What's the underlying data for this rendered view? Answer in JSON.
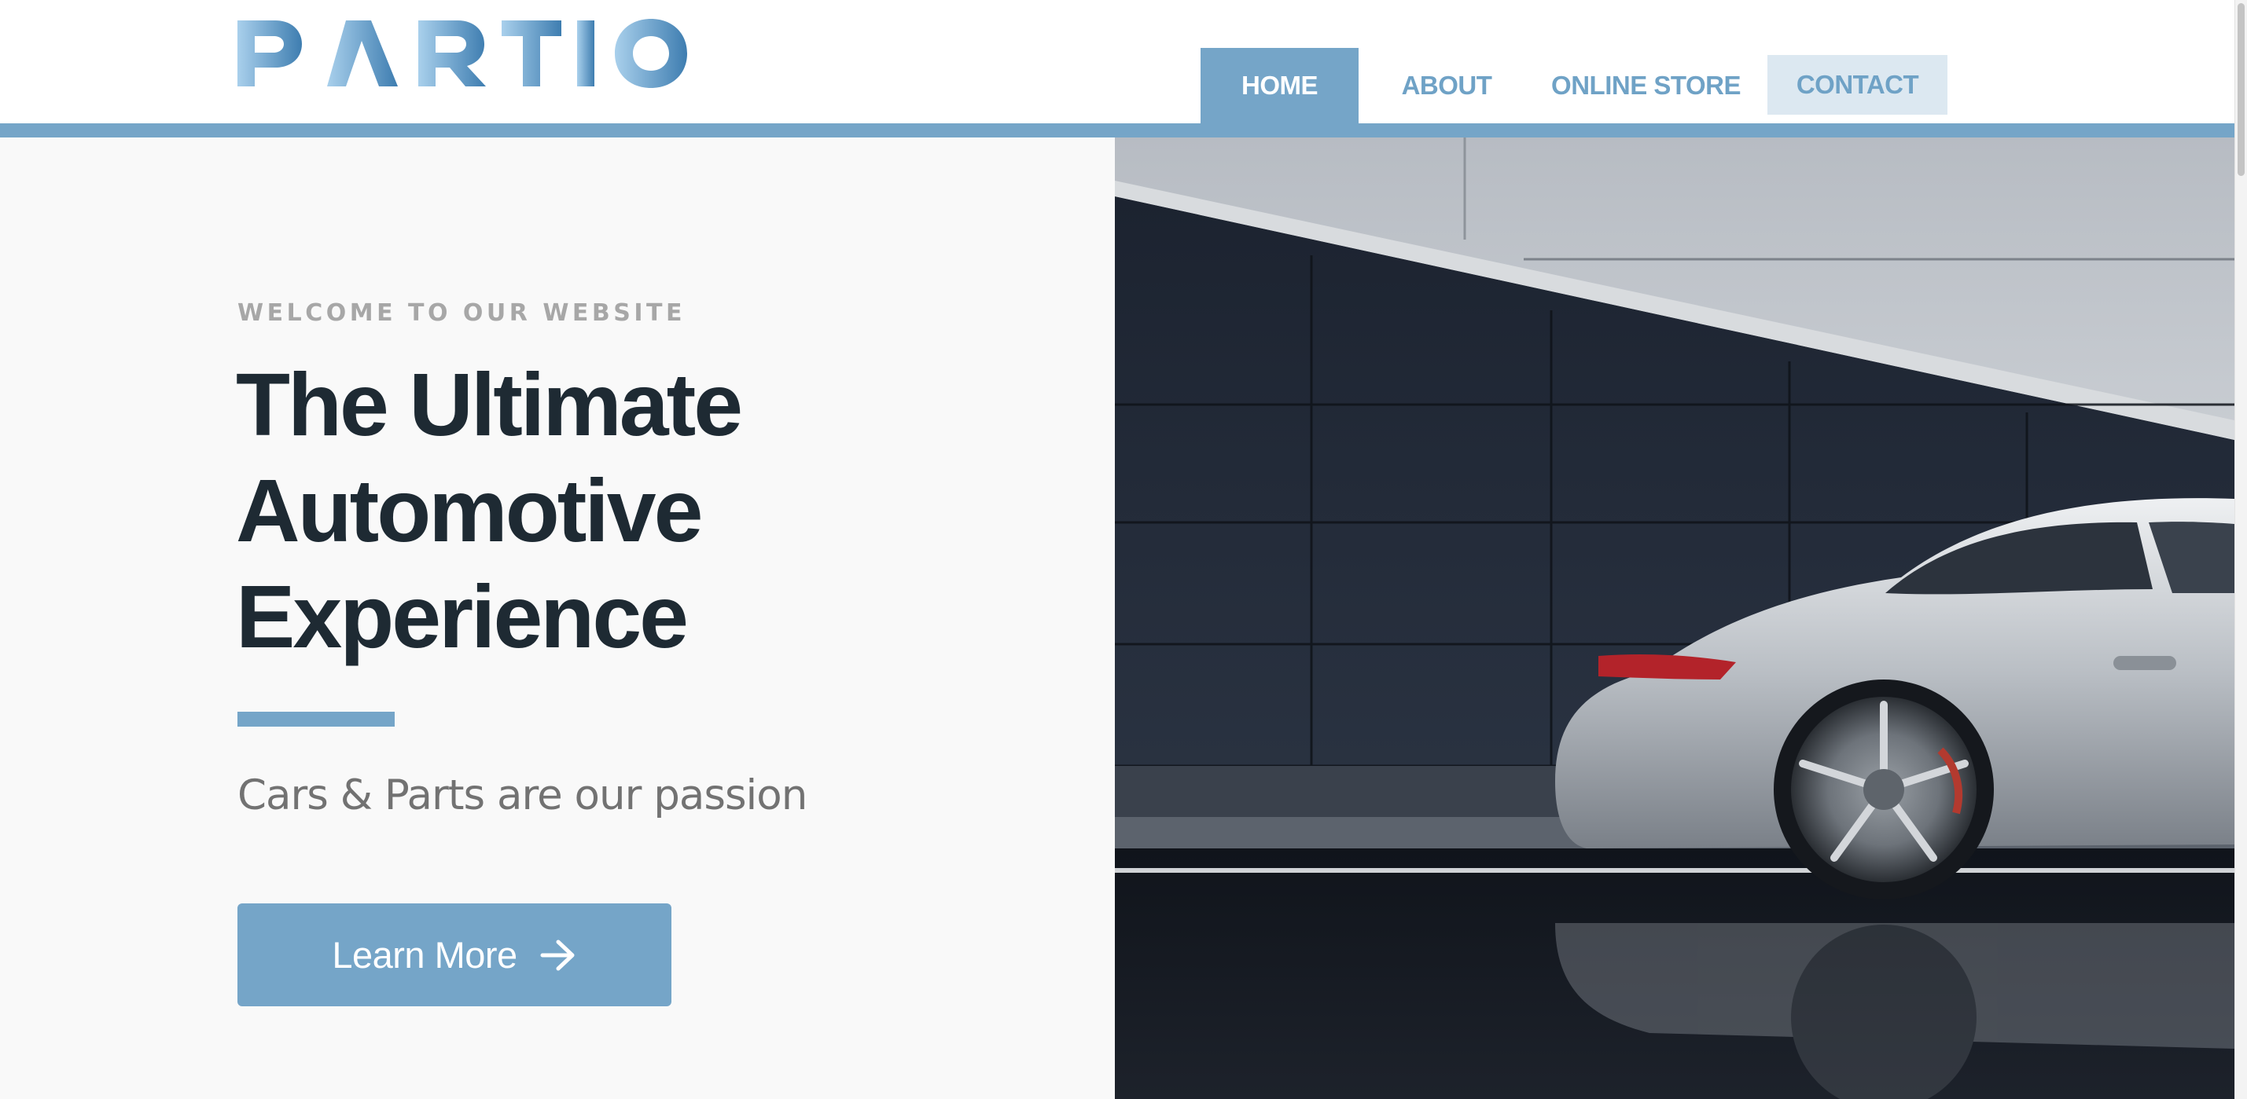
{
  "brand": {
    "logo_text": "PARTIO",
    "accent_color": "#75a5c8",
    "dark_color": "#1e2a33"
  },
  "nav": {
    "items": [
      {
        "label": "HOME",
        "active": true
      },
      {
        "label": "ABOUT",
        "active": false
      },
      {
        "label": "ONLINE STORE",
        "active": false
      },
      {
        "label": "CONTACT",
        "active": false,
        "highlighted": true
      }
    ]
  },
  "hero": {
    "eyebrow": "WELCOME TO OUR WEBSITE",
    "headline_lines": [
      "The Ultimate",
      "Automotive",
      "Experience"
    ],
    "tagline": "Cars & Parts are our passion",
    "cta_label": "Learn More",
    "cta_icon": "arrow-right-icon",
    "image_subject": "silver sports car beside dark tiled wall"
  }
}
